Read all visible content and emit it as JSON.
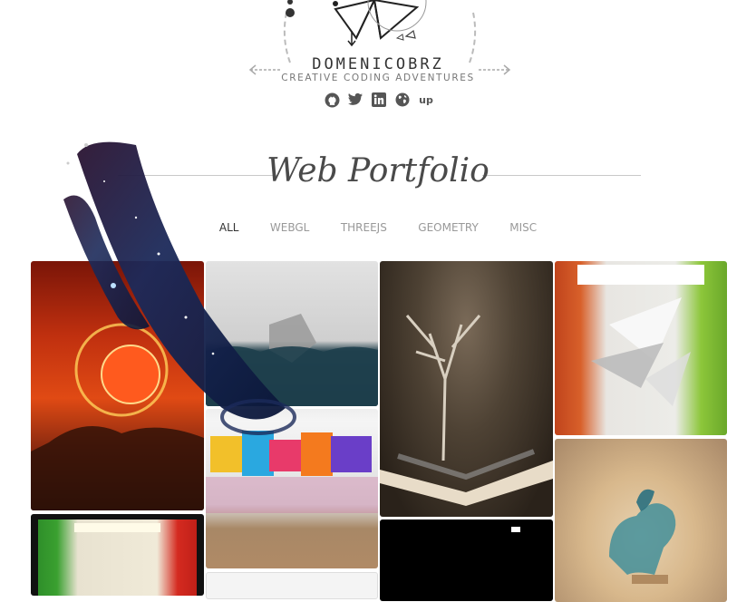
{
  "header": {
    "brand": "DOMENICOBRZ",
    "tagline": "CREATIVE CODING ADVENTURES"
  },
  "socials": [
    {
      "icon": "github-icon"
    },
    {
      "icon": "twitter-icon"
    },
    {
      "icon": "linkedin-icon"
    },
    {
      "icon": "globe-icon"
    },
    {
      "icon": "upwork-icon",
      "label": "up"
    }
  ],
  "section": {
    "title": "Web Portfolio"
  },
  "filters": [
    {
      "label": "ALL",
      "active": true
    },
    {
      "label": "WEBGL",
      "active": false
    },
    {
      "label": "THREEJS",
      "active": false
    },
    {
      "label": "GEOMETRY",
      "active": false
    },
    {
      "label": "MISC",
      "active": false
    }
  ],
  "colors": {
    "text_dark": "#333333",
    "text_muted": "#999999",
    "line": "#c8c8c8"
  }
}
